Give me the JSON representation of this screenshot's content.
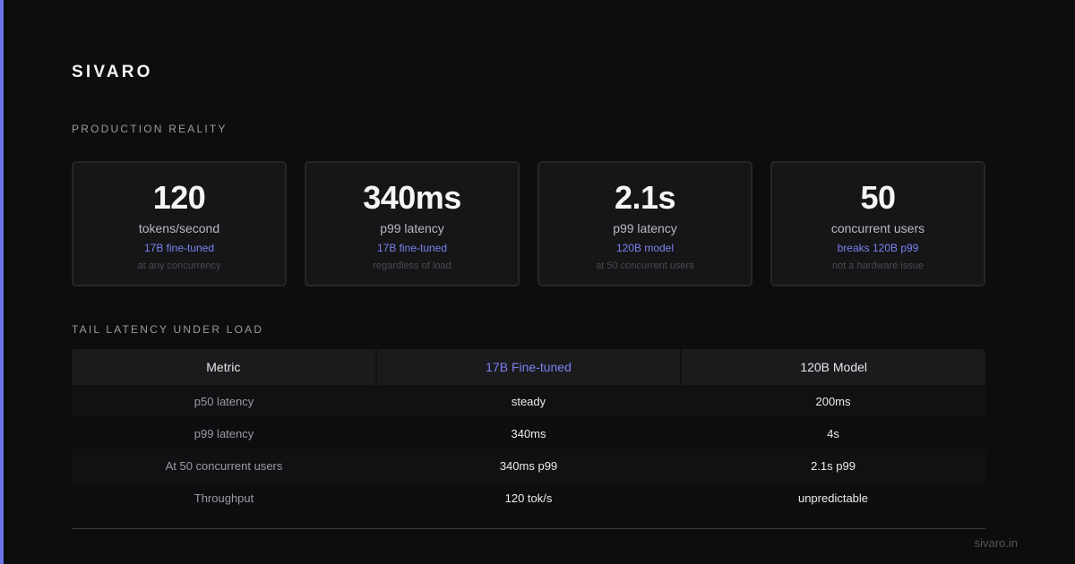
{
  "brand": {
    "logo_text": "SIVARO",
    "footer_url": "sivaro.in",
    "accent_color": "#6c74e8"
  },
  "sections": {
    "production_reality": "PRODUCTION REALITY",
    "tail_latency": "TAIL LATENCY UNDER LOAD"
  },
  "cards": [
    {
      "value": "120",
      "label": "tokens/second",
      "tag": "17B fine-tuned",
      "note": "at any concurrency"
    },
    {
      "value": "340ms",
      "label": "p99 latency",
      "tag": "17B fine-tuned",
      "note": "regardless of load"
    },
    {
      "value": "2.1s",
      "label": "p99 latency",
      "tag": "120B model",
      "note": "at 50 concurrent users"
    },
    {
      "value": "50",
      "label": "concurrent users",
      "tag": "breaks 120B p99",
      "note": "not a hardware issue"
    }
  ],
  "table": {
    "headers": [
      "Metric",
      "17B Fine-tuned",
      "120B Model"
    ],
    "rows": [
      [
        "p50 latency",
        "steady",
        "200ms"
      ],
      [
        "p99 latency",
        "340ms",
        "4s"
      ],
      [
        "At 50 concurrent users",
        "340ms p99",
        "2.1s p99"
      ],
      [
        "Throughput",
        "120 tok/s",
        "unpredictable"
      ]
    ]
  }
}
